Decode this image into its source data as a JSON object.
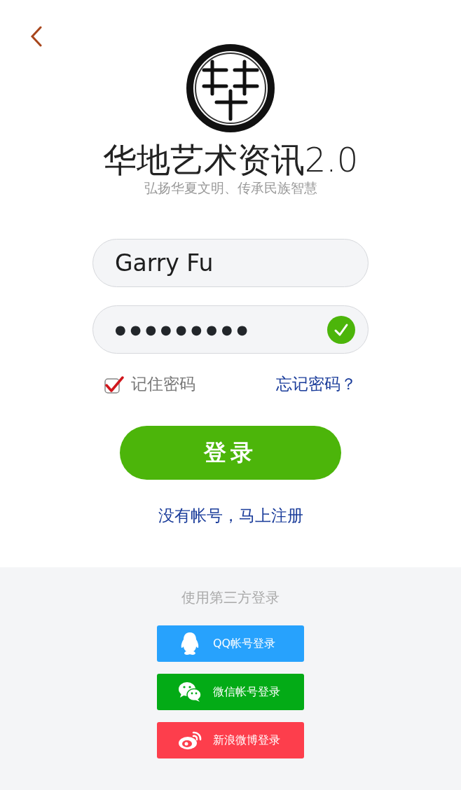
{
  "app": {
    "title": "华地艺术资讯2.0",
    "slogan": "弘扬华夏文明、传承民族智慧"
  },
  "username": {
    "value": "Garry Fu"
  },
  "password": {
    "value": "●●●●●●●●●",
    "valid": true
  },
  "remember": {
    "label": "记住密码",
    "checked": true
  },
  "forgot_link": "忘记密码？",
  "login_button": "登录",
  "register_link": "没有帐号，马上注册",
  "third_party": {
    "heading": "使用第三方登录",
    "buttons": [
      {
        "kind": "qq",
        "label": "QQ帐号登录",
        "color": "#27a2fd"
      },
      {
        "kind": "wechat",
        "label": "微信帐号登录",
        "color": "#03ab16"
      },
      {
        "kind": "weibo",
        "label": "新浪微博登录",
        "color": "#fd3e4c"
      }
    ]
  }
}
